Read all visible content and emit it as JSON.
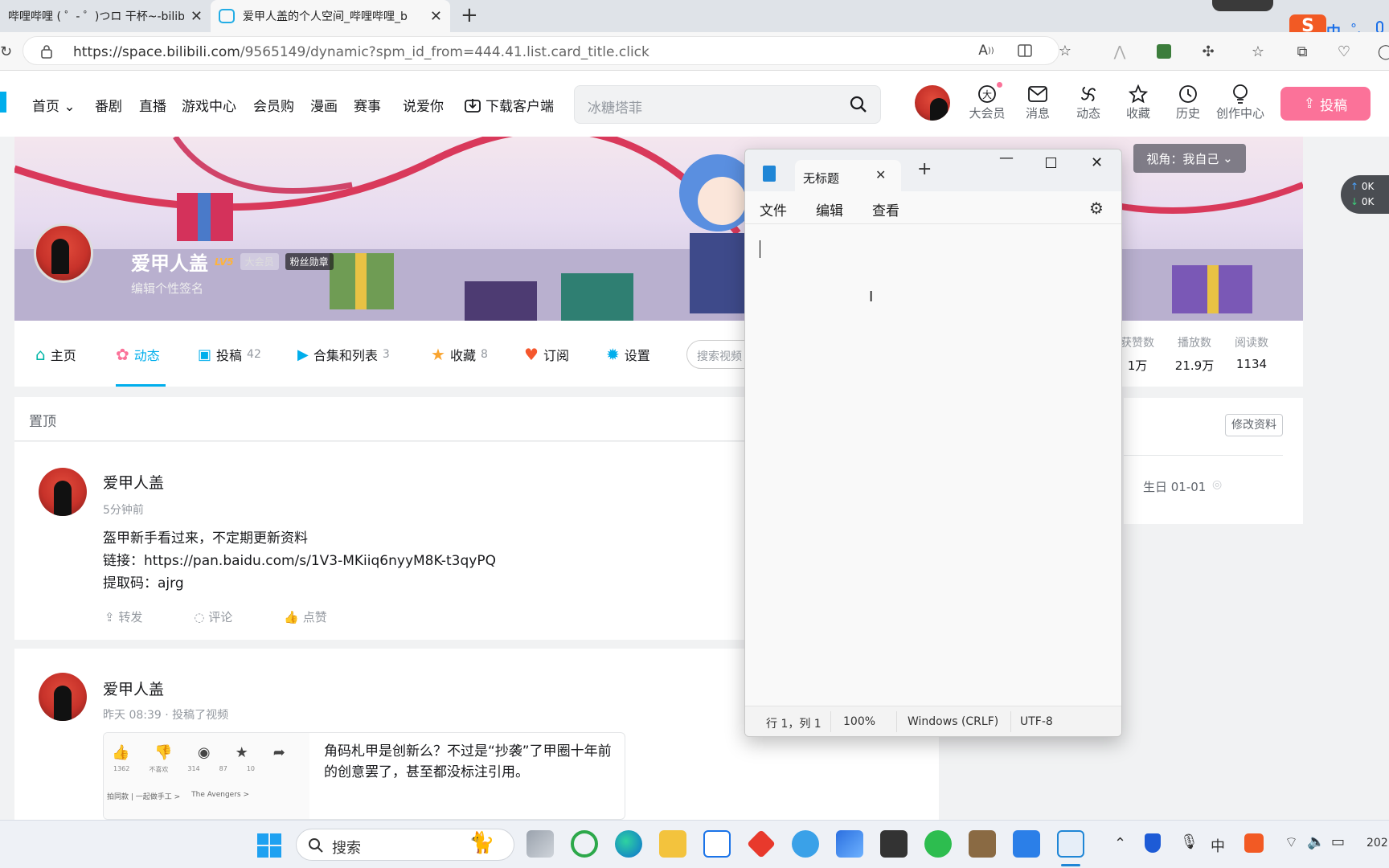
{
  "browser": {
    "tabs": [
      {
        "title": "哔哩哔哩 ( ゜- ゜)つロ 干杯~-bilib",
        "close": "✕"
      },
      {
        "title": "爱甲人盖的个人空间_哔哩哔哩_b",
        "close": "✕"
      }
    ],
    "new_tab": "+",
    "url_domain": "https://space.bilibili.com",
    "url_path": "/9565149/dynamic?spm_id_from=444.41.list.card_title.click"
  },
  "header": {
    "nav": [
      "首页",
      "番剧",
      "直播",
      "游戏中心",
      "会员购",
      "漫画",
      "赛事",
      "说爱你",
      "下载客户端"
    ],
    "search_placeholder": "冰糖塔菲",
    "icons": [
      "大会员",
      "消息",
      "动态",
      "收藏",
      "历史",
      "创作中心"
    ],
    "upload": "投稿"
  },
  "banner": {
    "username": "爱甲人盖",
    "level": "LV5",
    "vip": "大会员",
    "medal": "粉丝勋章",
    "signature": "编辑个性签名",
    "view_as": "视角：我自己"
  },
  "space_tabs": [
    {
      "label": "主页",
      "count": ""
    },
    {
      "label": "动态",
      "count": ""
    },
    {
      "label": "投稿",
      "count": "42"
    },
    {
      "label": "合集和列表",
      "count": "3"
    },
    {
      "label": "收藏",
      "count": "8"
    },
    {
      "label": "订阅",
      "count": ""
    },
    {
      "label": "设置",
      "count": ""
    }
  ],
  "space_search": "搜索视频",
  "stats": [
    {
      "label": "获赞数",
      "value": "1万"
    },
    {
      "label": "播放数",
      "value": "21.9万"
    },
    {
      "label": "阅读数",
      "value": "1134"
    }
  ],
  "side": {
    "edit_profile": "修改资料",
    "birthday": "生日 01-01"
  },
  "pinned": "置顶",
  "posts": [
    {
      "author": "爱甲人盖",
      "time": "5分钟前",
      "lines": [
        "盔甲新手看过来，不定期更新资料",
        "链接：https://pan.baidu.com/s/1V3-MKiiq6nyyM8K-t3qyPQ",
        "提取码：ajrg"
      ],
      "actions": [
        "转发",
        "评论",
        "点赞"
      ]
    },
    {
      "author": "爱甲人盖",
      "time": "昨天 08:39 · 投稿了视频",
      "video_text": "角码札甲是创新么？不过是“抄袭”了甲圈十年前的创意罢了，甚至都没标注引用。",
      "thumb_counts": [
        "1362",
        "不喜欢",
        "314",
        "87",
        "10"
      ],
      "thumb_tags": [
        "拍同款 | 一起做手工 >",
        "The Avengers >"
      ]
    }
  ],
  "notepad": {
    "tab_title": "无标题",
    "menu": [
      "文件",
      "编辑",
      "查看"
    ],
    "status": [
      "行 1，列 1",
      "100%",
      "Windows (CRLF)",
      "UTF-8"
    ]
  },
  "ime": {
    "lang": "中",
    "punct": "°,"
  },
  "taskbar": {
    "search": "搜索",
    "tray_lang": "中",
    "clock": "202"
  },
  "side_widget": [
    "0K",
    "0K"
  ]
}
